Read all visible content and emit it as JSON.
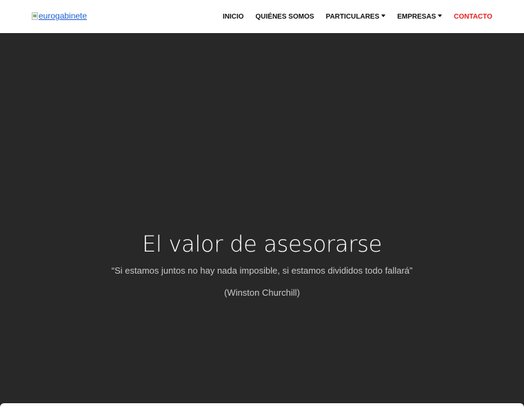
{
  "logo": {
    "alt_text": "eurogabinete"
  },
  "nav": {
    "items": [
      {
        "label": "INICIO"
      },
      {
        "label": "QUIÉNES SOMOS"
      },
      {
        "label": "PARTICULARES"
      },
      {
        "label": "EMPRESAS"
      },
      {
        "label": "CONTACTO"
      }
    ]
  },
  "hero": {
    "title": "El valor de asesorarse",
    "quote": "“Si estamos juntos no hay nada imposible, si estamos divididos todo fallará”",
    "author": "(Winston Churchill)"
  },
  "colors": {
    "hero_background": "#282828",
    "accent": "#e4201e",
    "link": "#1a5fd1"
  }
}
